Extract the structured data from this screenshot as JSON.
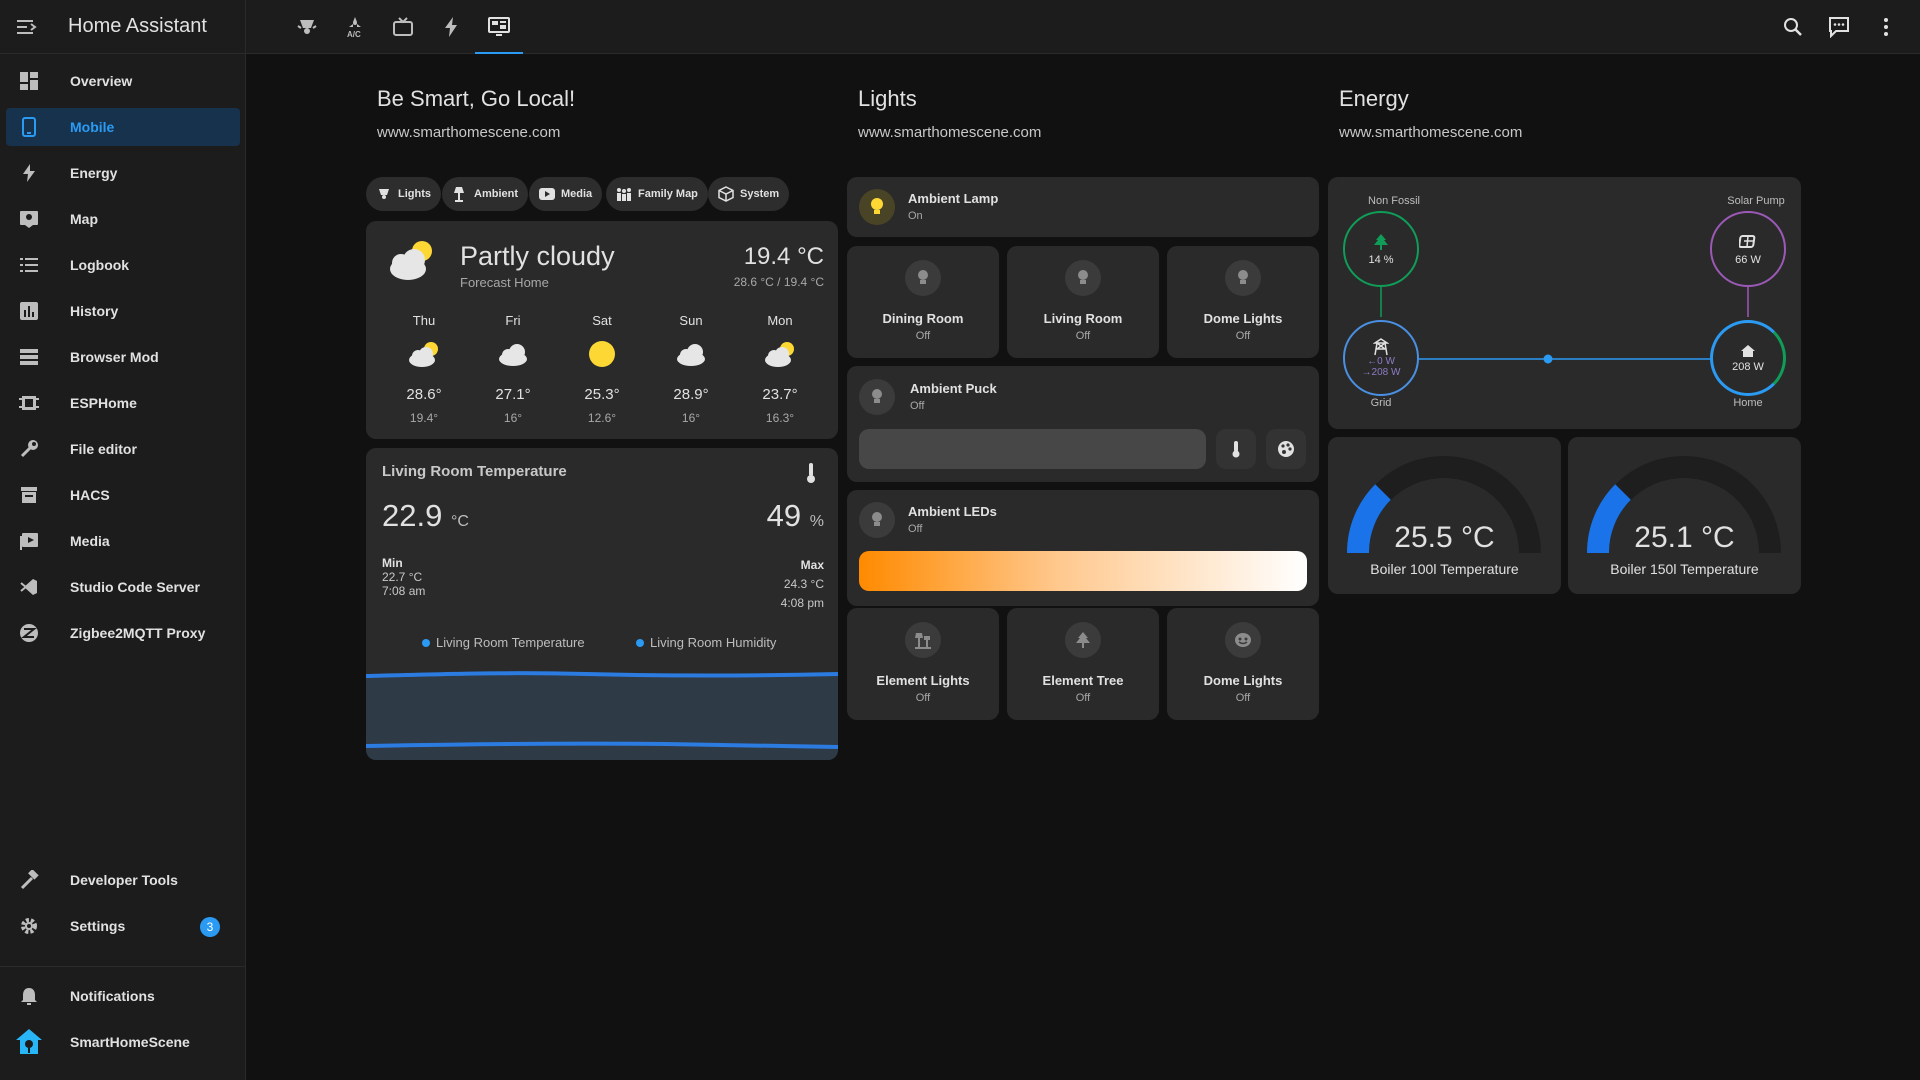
{
  "app": {
    "title": "Home Assistant"
  },
  "sidebar": {
    "items": [
      {
        "label": "Overview",
        "icon": "dashboard-icon"
      },
      {
        "label": "Mobile",
        "icon": "mobile-icon",
        "active": true
      },
      {
        "label": "Energy",
        "icon": "lightning-icon"
      },
      {
        "label": "Map",
        "icon": "map-icon"
      },
      {
        "label": "Logbook",
        "icon": "list-icon"
      },
      {
        "label": "History",
        "icon": "chart-bar-icon"
      },
      {
        "label": "Browser Mod",
        "icon": "server-icon"
      },
      {
        "label": "ESPHome",
        "icon": "chip-icon"
      },
      {
        "label": "File editor",
        "icon": "wrench-icon"
      },
      {
        "label": "HACS",
        "icon": "hacs-icon"
      },
      {
        "label": "Media",
        "icon": "media-icon"
      },
      {
        "label": "Studio Code Server",
        "icon": "vscode-icon"
      },
      {
        "label": "Zigbee2MQTT Proxy",
        "icon": "zigbee-icon"
      }
    ],
    "developer_tools": "Developer Tools",
    "settings": "Settings",
    "settings_badge": "3",
    "notifications": "Notifications",
    "user": "SmartHomeScene"
  },
  "topbar": {
    "tabs": [
      "lights-tab",
      "climate-tab",
      "tv-tab",
      "energy-tab",
      "mobile-dashboard-tab"
    ],
    "active_tab": 4
  },
  "columns": {
    "c1": {
      "title": "Be Smart, Go Local!",
      "subtitle": "www.smarthomescene.com"
    },
    "c2": {
      "title": "Lights",
      "subtitle": "www.smarthomescene.com"
    },
    "c3": {
      "title": "Energy",
      "subtitle": "www.smarthomescene.com"
    }
  },
  "chips": [
    "Lights",
    "Ambient",
    "Media",
    "Family Map",
    "System"
  ],
  "weather": {
    "condition": "Partly cloudy",
    "location": "Forecast Home",
    "temperature": "19.4 °C",
    "hilo": "28.6 °C / 19.4 °C",
    "forecast": [
      {
        "day": "Thu",
        "icon": "partly-cloudy-icon",
        "hi": "28.6°",
        "lo": "19.4°"
      },
      {
        "day": "Fri",
        "icon": "cloudy-icon",
        "hi": "27.1°",
        "lo": "16°"
      },
      {
        "day": "Sat",
        "icon": "sunny-icon",
        "hi": "25.3°",
        "lo": "12.6°"
      },
      {
        "day": "Sun",
        "icon": "cloudy-icon",
        "hi": "28.9°",
        "lo": "16°"
      },
      {
        "day": "Mon",
        "icon": "partly-cloudy-icon",
        "hi": "23.7°",
        "lo": "16.3°"
      }
    ]
  },
  "sensor": {
    "title": "Living Room Temperature",
    "temp": "22.9",
    "temp_unit": "°C",
    "humidity": "49",
    "humidity_unit": "%",
    "min_label": "Min",
    "min_value": "22.7 °C",
    "min_time": "7:08 am",
    "max_label": "Max",
    "max_value": "24.3 °C",
    "max_time": "4:08 pm",
    "legend": [
      "Living Room Temperature",
      "Living Room Humidity"
    ]
  },
  "lights": {
    "ambient_lamp": {
      "name": "Ambient Lamp",
      "state": "On"
    },
    "row1": [
      {
        "name": "Dining Room",
        "state": "Off"
      },
      {
        "name": "Living Room",
        "state": "Off"
      },
      {
        "name": "Dome Lights",
        "state": "Off"
      }
    ],
    "ambient_puck": {
      "name": "Ambient Puck",
      "state": "Off"
    },
    "ambient_leds": {
      "name": "Ambient LEDs",
      "state": "Off"
    },
    "row2": [
      {
        "name": "Element Lights",
        "state": "Off",
        "icon": "lamp-icon"
      },
      {
        "name": "Element Tree",
        "state": "Off",
        "icon": "tree-icon"
      },
      {
        "name": "Dome Lights",
        "state": "Off",
        "icon": "dome-icon"
      }
    ]
  },
  "energy": {
    "non_fossil": {
      "label": "Non Fossil",
      "value": "14 %"
    },
    "solar": {
      "label": "Solar Pump",
      "value": "66 W"
    },
    "grid": {
      "label": "Grid",
      "in": "←0 W",
      "out": "→208 W"
    },
    "home": {
      "label": "Home",
      "value": "208 W"
    },
    "gauges": [
      {
        "value": "25.5 °C",
        "name": "Boiler 100l Temperature"
      },
      {
        "value": "25.1 °C",
        "name": "Boiler 150l Temperature"
      }
    ]
  },
  "colors": {
    "accent": "#2b9af3",
    "bulb_on": "#fdd835",
    "non_fossil": "#0f9d58",
    "solar": "#9b59b6",
    "orange": "#ff9800"
  }
}
